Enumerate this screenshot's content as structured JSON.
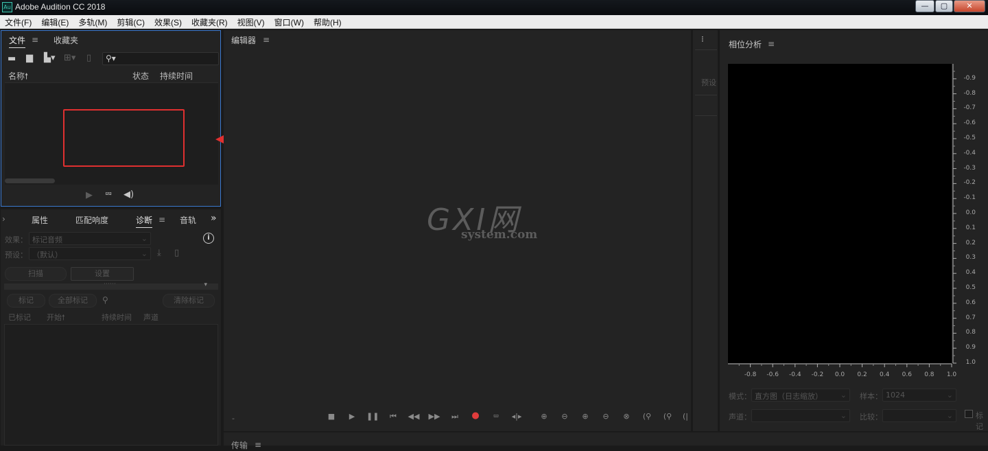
{
  "window": {
    "app_icon": "Au",
    "title": "Adobe Audition CC 2018",
    "controls": {
      "minimize": "—",
      "maximize": "▢",
      "close": "✕"
    }
  },
  "menu": [
    "文件(F)",
    "编辑(E)",
    "多轨(M)",
    "剪辑(C)",
    "效果(S)",
    "收藏夹(R)",
    "视图(V)",
    "窗口(W)",
    "帮助(H)"
  ],
  "files_panel": {
    "tabs": {
      "files": "文件",
      "favorites": "收藏夹"
    },
    "columns": {
      "name": "名称",
      "status": "状态",
      "duration": "持续时间"
    }
  },
  "diag_panel": {
    "tabs": {
      "left_arrow": "›",
      "properties": "属性",
      "match_loudness": "匹配响度",
      "diagnostics": "诊断",
      "audio": "音轨",
      "more": "»"
    },
    "effect_label": "效果：",
    "effect_value": "标记音频",
    "preset_label": "预设：",
    "preset_value": "（默认）",
    "scan_button": "扫描",
    "settings_button": "设置",
    "mark_button": "标记",
    "mark_all_button": "全部标记",
    "clear_marks_button": "清除标记",
    "columns": {
      "marked": "已标记",
      "start": "开始",
      "duration": "持续时间",
      "channel": "声道"
    }
  },
  "editor": {
    "title": "编辑器",
    "time_display": "-",
    "watermark": {
      "logo": "GXI网",
      "domain": "system.com"
    }
  },
  "side_strip": {
    "presets_label": "预设",
    "menu": "⁝"
  },
  "bottom_panel": {
    "title": "传输"
  },
  "phase_panel": {
    "title": "相位分析",
    "mode_label": "模式：",
    "mode_value": "直方图（日志缩放）",
    "sample_label": "样本：",
    "sample_value": "1024",
    "channel_label": "声道：",
    "compare_label": "比较：",
    "checkbox_label": "标记"
  },
  "chart_data": {
    "type": "heatmap",
    "title": "相位分析",
    "x_ticks": [
      "-0.8",
      "-0.6",
      "-0.4",
      "-0.2",
      "0.0",
      "0.2",
      "0.4",
      "0.6",
      "0.8",
      "1.0"
    ],
    "y_ticks": [
      "-0.9",
      "-0.8",
      "-0.7",
      "-0.6",
      "-0.5",
      "-0.4",
      "-0.3",
      "-0.2",
      "-0.1",
      "0.0",
      "0.1",
      "0.2",
      "0.3",
      "0.4",
      "0.5",
      "0.6",
      "0.7",
      "0.8",
      "0.9",
      "1.0"
    ],
    "xlim": [
      -1.0,
      1.0
    ],
    "ylim": [
      -1.0,
      1.0
    ],
    "values": [],
    "background": "#000000"
  },
  "colors": {
    "accent_blue": "#3a79d0",
    "annotation_red": "#e03030",
    "record_red": "#e03c3c"
  }
}
